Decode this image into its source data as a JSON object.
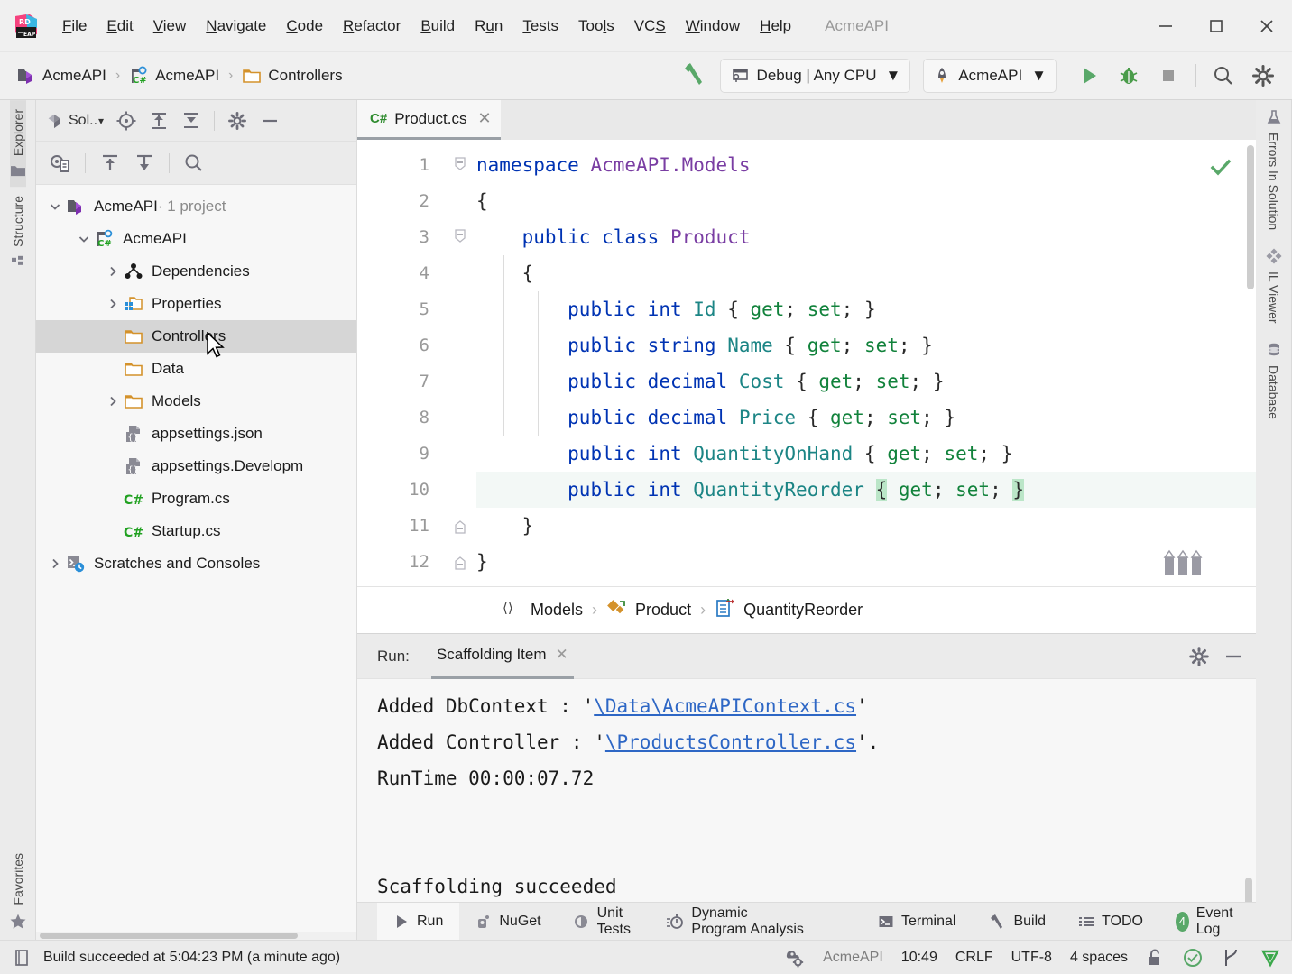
{
  "window": {
    "title": "AcmeAPI",
    "minimize": "—",
    "maximize": "☐",
    "close": "✕"
  },
  "menu": {
    "logo_icon": "rider-logo-icon",
    "items": [
      {
        "label": "File",
        "mnemonic": "F"
      },
      {
        "label": "Edit",
        "mnemonic": "E"
      },
      {
        "label": "View",
        "mnemonic": "V"
      },
      {
        "label": "Navigate",
        "mnemonic": "N"
      },
      {
        "label": "Code",
        "mnemonic": "C"
      },
      {
        "label": "Refactor",
        "mnemonic": "R"
      },
      {
        "label": "Build",
        "mnemonic": "B"
      },
      {
        "label": "Run",
        "mnemonic": "u"
      },
      {
        "label": "Tests",
        "mnemonic": "T"
      },
      {
        "label": "Tools",
        "mnemonic": "l"
      },
      {
        "label": "VCS",
        "mnemonic": "S"
      },
      {
        "label": "Window",
        "mnemonic": "W"
      },
      {
        "label": "Help",
        "mnemonic": "H"
      }
    ]
  },
  "toolbar": {
    "breadcrumb": [
      {
        "label": "AcmeAPI",
        "icon": "solution-icon"
      },
      {
        "label": "AcmeAPI",
        "icon": "csharp-project-icon"
      },
      {
        "label": "Controllers",
        "icon": "folder-icon"
      }
    ],
    "build_icon": "hammer-icon",
    "config": {
      "label": "Debug | Any CPU",
      "icon": "configuration-icon",
      "caret": "▼"
    },
    "run_config": {
      "label": "AcmeAPI",
      "icon": "rocket-icon",
      "caret": "▼"
    },
    "run_icon": "run-play-icon",
    "debug_icon": "debug-bug-icon",
    "stop_icon": "stop-square-icon",
    "search_icon": "search-icon",
    "settings_icon": "gear-icon"
  },
  "left_rail": {
    "tabs": [
      {
        "label": "Explorer",
        "icon": "folder-icon",
        "active": true
      },
      {
        "label": "Structure",
        "icon": "structure-icon",
        "active": false
      }
    ],
    "bottom_tabs": [
      {
        "label": "Favorites",
        "icon": "star-icon",
        "active": false
      }
    ]
  },
  "right_rail": {
    "tabs": [
      {
        "label": "Errors In Solution",
        "icon": "flask-icon"
      },
      {
        "label": "IL Viewer",
        "icon": "diamonds-icon"
      },
      {
        "label": "Database",
        "icon": "database-icon"
      }
    ]
  },
  "explorer": {
    "title": "Sol..",
    "title_caret": "▾",
    "title_icon": "solution-icon",
    "toolbar_row1": [
      {
        "name": "locate-icon"
      },
      {
        "name": "expand-all-icon"
      },
      {
        "name": "collapse-all-icon"
      },
      {
        "name": "gear-icon"
      },
      {
        "name": "hide-icon"
      }
    ],
    "toolbar_row2": [
      {
        "name": "show-all-files-icon"
      },
      {
        "name": "move-up-icon"
      },
      {
        "name": "move-down-icon"
      },
      {
        "name": "search-icon"
      }
    ],
    "tree": [
      {
        "label": "AcmeAPI",
        "suffix": " · 1 project",
        "indent": 0,
        "twisty": "expanded",
        "icon": "solution-icon",
        "selected": false
      },
      {
        "label": "AcmeAPI",
        "suffix": "",
        "indent": 1,
        "twisty": "expanded",
        "icon": "csharp-project-icon",
        "selected": false
      },
      {
        "label": "Dependencies",
        "suffix": "",
        "indent": 2,
        "twisty": "collapsed",
        "icon": "dependencies-icon",
        "selected": false
      },
      {
        "label": "Properties",
        "suffix": "",
        "indent": 2,
        "twisty": "collapsed",
        "icon": "properties-icon",
        "selected": false
      },
      {
        "label": "Controllers",
        "suffix": "",
        "indent": 2,
        "twisty": "none",
        "icon": "folder-icon",
        "selected": true
      },
      {
        "label": "Data",
        "suffix": "",
        "indent": 2,
        "twisty": "none",
        "icon": "folder-icon",
        "selected": false
      },
      {
        "label": "Models",
        "suffix": "",
        "indent": 2,
        "twisty": "collapsed",
        "icon": "folder-icon",
        "selected": false
      },
      {
        "label": "appsettings.json",
        "suffix": "",
        "indent": 2,
        "twisty": "none",
        "icon": "json-file-icon",
        "selected": false
      },
      {
        "label": "appsettings.Developm",
        "suffix": "",
        "indent": 2,
        "twisty": "none",
        "icon": "json-file-icon",
        "selected": false
      },
      {
        "label": "Program.cs",
        "suffix": "",
        "indent": 2,
        "twisty": "none",
        "icon": "csharp-file-icon",
        "selected": false
      },
      {
        "label": "Startup.cs",
        "suffix": "",
        "indent": 2,
        "twisty": "none",
        "icon": "csharp-file-icon",
        "selected": false
      },
      {
        "label": "Scratches and Consoles",
        "suffix": "",
        "indent": 0,
        "twisty": "collapsed",
        "icon": "scratches-icon",
        "selected": false
      }
    ]
  },
  "editor": {
    "tab": {
      "label": "Product.cs",
      "badge": "C#",
      "close": "✕"
    },
    "status_icon": "inspection-ok-icon",
    "line_numbers": [
      "1",
      "2",
      "3",
      "4",
      "5",
      "6",
      "7",
      "8",
      "9",
      "10",
      "11",
      "12"
    ],
    "lines": [
      {
        "n": 1,
        "tokens": [
          {
            "t": "namespace",
            "c": "kw"
          },
          {
            "t": " ",
            "c": "pun"
          },
          {
            "t": "AcmeAPI.Models",
            "c": "ns"
          }
        ],
        "indent": 0,
        "fold": "open",
        "current": false
      },
      {
        "n": 2,
        "tokens": [
          {
            "t": "{",
            "c": "pun"
          }
        ],
        "indent": 0,
        "fold": "none",
        "current": false
      },
      {
        "n": 3,
        "tokens": [
          {
            "t": "    ",
            "c": "pun"
          },
          {
            "t": "public",
            "c": "kw"
          },
          {
            "t": " ",
            "c": "pun"
          },
          {
            "t": "class",
            "c": "kw"
          },
          {
            "t": " ",
            "c": "pun"
          },
          {
            "t": "Product",
            "c": "cls"
          }
        ],
        "indent": 1,
        "fold": "open",
        "current": false
      },
      {
        "n": 4,
        "tokens": [
          {
            "t": "    ",
            "c": "pun"
          },
          {
            "t": "{",
            "c": "pun"
          }
        ],
        "indent": 1,
        "fold": "none",
        "current": false
      },
      {
        "n": 5,
        "tokens": [
          {
            "t": "        ",
            "c": "pun"
          },
          {
            "t": "public",
            "c": "kw"
          },
          {
            "t": " ",
            "c": "pun"
          },
          {
            "t": "int",
            "c": "kw"
          },
          {
            "t": " ",
            "c": "pun"
          },
          {
            "t": "Id",
            "c": "prop"
          },
          {
            "t": " { ",
            "c": "pun"
          },
          {
            "t": "get",
            "c": "acc"
          },
          {
            "t": "; ",
            "c": "pun"
          },
          {
            "t": "set",
            "c": "acc"
          },
          {
            "t": "; }",
            "c": "pun"
          }
        ],
        "indent": 2,
        "fold": "none",
        "current": false
      },
      {
        "n": 6,
        "tokens": [
          {
            "t": "        ",
            "c": "pun"
          },
          {
            "t": "public",
            "c": "kw"
          },
          {
            "t": " ",
            "c": "pun"
          },
          {
            "t": "string",
            "c": "kw"
          },
          {
            "t": " ",
            "c": "pun"
          },
          {
            "t": "Name",
            "c": "prop"
          },
          {
            "t": " { ",
            "c": "pun"
          },
          {
            "t": "get",
            "c": "acc"
          },
          {
            "t": "; ",
            "c": "pun"
          },
          {
            "t": "set",
            "c": "acc"
          },
          {
            "t": "; }",
            "c": "pun"
          }
        ],
        "indent": 2,
        "fold": "none",
        "current": false
      },
      {
        "n": 7,
        "tokens": [
          {
            "t": "        ",
            "c": "pun"
          },
          {
            "t": "public",
            "c": "kw"
          },
          {
            "t": " ",
            "c": "pun"
          },
          {
            "t": "decimal",
            "c": "kw"
          },
          {
            "t": " ",
            "c": "pun"
          },
          {
            "t": "Cost",
            "c": "prop"
          },
          {
            "t": " { ",
            "c": "pun"
          },
          {
            "t": "get",
            "c": "acc"
          },
          {
            "t": "; ",
            "c": "pun"
          },
          {
            "t": "set",
            "c": "acc"
          },
          {
            "t": "; }",
            "c": "pun"
          }
        ],
        "indent": 2,
        "fold": "none",
        "current": false
      },
      {
        "n": 8,
        "tokens": [
          {
            "t": "        ",
            "c": "pun"
          },
          {
            "t": "public",
            "c": "kw"
          },
          {
            "t": " ",
            "c": "pun"
          },
          {
            "t": "decimal",
            "c": "kw"
          },
          {
            "t": " ",
            "c": "pun"
          },
          {
            "t": "Price",
            "c": "prop"
          },
          {
            "t": " { ",
            "c": "pun"
          },
          {
            "t": "get",
            "c": "acc"
          },
          {
            "t": "; ",
            "c": "pun"
          },
          {
            "t": "set",
            "c": "acc"
          },
          {
            "t": "; }",
            "c": "pun"
          }
        ],
        "indent": 2,
        "fold": "none",
        "current": false
      },
      {
        "n": 9,
        "tokens": [
          {
            "t": "        ",
            "c": "pun"
          },
          {
            "t": "public",
            "c": "kw"
          },
          {
            "t": " ",
            "c": "pun"
          },
          {
            "t": "int",
            "c": "kw"
          },
          {
            "t": " ",
            "c": "pun"
          },
          {
            "t": "QuantityOnHand",
            "c": "prop"
          },
          {
            "t": " { ",
            "c": "pun"
          },
          {
            "t": "get",
            "c": "acc"
          },
          {
            "t": "; ",
            "c": "pun"
          },
          {
            "t": "set",
            "c": "acc"
          },
          {
            "t": "; }",
            "c": "pun"
          }
        ],
        "indent": 2,
        "fold": "none",
        "current": false
      },
      {
        "n": 10,
        "tokens": [
          {
            "t": "        ",
            "c": "pun"
          },
          {
            "t": "public",
            "c": "kw"
          },
          {
            "t": " ",
            "c": "pun"
          },
          {
            "t": "int",
            "c": "kw"
          },
          {
            "t": " ",
            "c": "pun"
          },
          {
            "t": "QuantityReorder",
            "c": "prop"
          },
          {
            "t": " ",
            "c": "pun"
          },
          {
            "t": "{",
            "c": "pun brhl"
          },
          {
            "t": " ",
            "c": "pun"
          },
          {
            "t": "get",
            "c": "acc"
          },
          {
            "t": "; ",
            "c": "pun"
          },
          {
            "t": "set",
            "c": "acc"
          },
          {
            "t": "; ",
            "c": "pun"
          },
          {
            "t": "}",
            "c": "pun brhl"
          }
        ],
        "indent": 2,
        "fold": "none",
        "current": true
      },
      {
        "n": 11,
        "tokens": [
          {
            "t": "    ",
            "c": "pun"
          },
          {
            "t": "}",
            "c": "pun"
          }
        ],
        "indent": 1,
        "fold": "close",
        "current": false
      },
      {
        "n": 12,
        "tokens": [
          {
            "t": "}",
            "c": "pun"
          }
        ],
        "indent": 0,
        "fold": "close",
        "current": false
      }
    ],
    "pencils_icon": "pencils-icon",
    "breadcrumbs": [
      {
        "label": "Models",
        "icon": "namespace-icon"
      },
      {
        "label": "Product",
        "icon": "class-icon"
      },
      {
        "label": "QuantityReorder",
        "icon": "property-icon"
      }
    ],
    "breadcrumb_separator": "›"
  },
  "run_panel": {
    "label": "Run:",
    "tab": {
      "label": "Scaffolding Item",
      "close": "✕"
    },
    "gear_icon": "gear-icon",
    "hide_icon": "hide-icon",
    "output": [
      {
        "segments": [
          {
            "t": "Added DbContext : '",
            "link": false
          },
          {
            "t": "\\Data\\AcmeAPIContext.cs",
            "link": true
          },
          {
            "t": "'",
            "link": false
          }
        ]
      },
      {
        "segments": [
          {
            "t": "Added Controller : '",
            "link": false
          },
          {
            "t": "\\ProductsController.cs",
            "link": true
          },
          {
            "t": "'.",
            "link": false
          }
        ]
      },
      {
        "segments": [
          {
            "t": "RunTime 00:00:07.72",
            "link": false
          }
        ]
      },
      {
        "segments": [
          {
            "t": "",
            "link": false
          }
        ]
      },
      {
        "segments": [
          {
            "t": "",
            "link": false
          }
        ]
      },
      {
        "segments": [
          {
            "t": "Scaffolding succeeded",
            "link": false
          }
        ]
      }
    ]
  },
  "bottom_tabs": [
    {
      "label": "Run",
      "icon": "run-play-icon",
      "active": true,
      "badge": null
    },
    {
      "label": "NuGet",
      "icon": "nuget-icon",
      "active": false,
      "badge": null
    },
    {
      "label": "Unit Tests",
      "icon": "unit-tests-icon",
      "active": false,
      "badge": null
    },
    {
      "label": "Dynamic Program Analysis",
      "icon": "dpa-icon",
      "active": false,
      "badge": null
    },
    {
      "label": "Terminal",
      "icon": "terminal-icon",
      "active": false,
      "badge": null
    },
    {
      "label": "Build",
      "icon": "hammer-icon",
      "active": false,
      "badge": null
    },
    {
      "label": "TODO",
      "icon": "todo-list-icon",
      "active": false,
      "badge": null
    },
    {
      "label": "Event Log",
      "icon": "event-log-icon",
      "active": false,
      "badge": "4"
    }
  ],
  "statusbar": {
    "build_icon": "build-status-icon",
    "message": "Build succeeded at 5:04:23 PM (a minute ago)",
    "project_icon": "project-settings-icon",
    "project": "AcmeAPI",
    "position": "10:49",
    "line_separator": "CRLF",
    "encoding": "UTF-8",
    "indent": "4 spaces",
    "lock_icon": "unlocked-icon",
    "inspection_icon": "inspection-ok-icon",
    "branch_icon": "branch-icon",
    "rider_icon": "rider-status-icon"
  },
  "colors": {
    "accent_green": "#59a869",
    "keyword_blue": "#0033b3",
    "type_purple": "#7a3ea3",
    "property_teal": "#1c8585",
    "accessor_green": "#11823b",
    "link_blue": "#2e67c5",
    "brace_highlight": "#bbe6c8",
    "folder_orange": "#d4922b"
  }
}
